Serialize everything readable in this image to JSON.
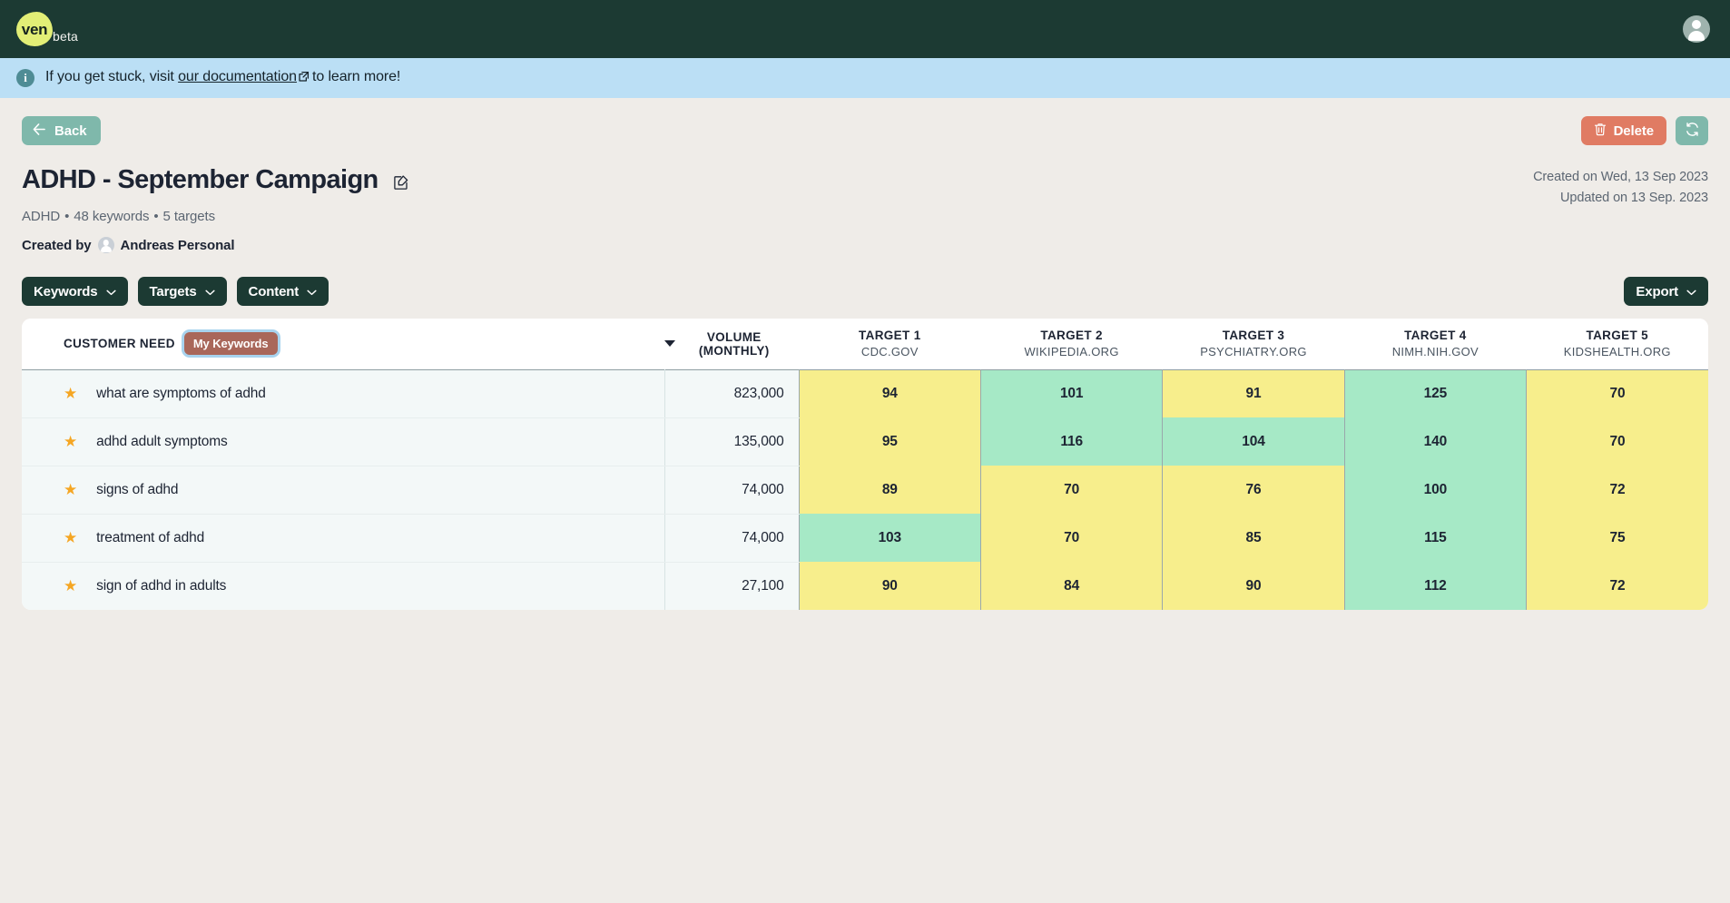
{
  "topbar": {
    "brand_name": "ven",
    "brand_beta": "beta",
    "avatar_icon": "user-avatar-icon"
  },
  "banner": {
    "icon": "info-icon",
    "text_before": "If you get stuck, visit",
    "link_text": "our documentation",
    "external_icon": "external-link-icon",
    "text_after": "to learn more!"
  },
  "actions": {
    "back_label": "Back",
    "back_icon": "arrow-left-icon",
    "delete_label": "Delete",
    "delete_icon": "trash-icon",
    "refresh_icon": "refresh-icon"
  },
  "header": {
    "title": "ADHD - September Campaign",
    "edit_icon": "edit-pencil-icon",
    "topic": "ADHD",
    "keywords_count": "48 keywords",
    "targets_count": "5 targets",
    "created_by_label": "Created by",
    "created_by_name": "Andreas Personal",
    "created_on": "Created on Wed, 13 Sep 2023",
    "updated_on": "Updated on 13 Sep. 2023"
  },
  "filters": {
    "keywords_label": "Keywords",
    "targets_label": "Targets",
    "content_label": "Content",
    "export_label": "Export",
    "chevron_icon": "chevron-down-icon"
  },
  "table": {
    "col_customer_need": "CUSTOMER NEED",
    "my_keywords_label": "My Keywords",
    "col_volume": "VOLUME (MONTHLY)",
    "sort_icon": "caret-down-icon",
    "targets": [
      {
        "label": "TARGET 1",
        "domain": "CDC.GOV"
      },
      {
        "label": "TARGET 2",
        "domain": "WIKIPEDIA.ORG"
      },
      {
        "label": "TARGET 3",
        "domain": "PSYCHIATRY.ORG"
      },
      {
        "label": "TARGET 4",
        "domain": "NIMH.NIH.GOV"
      },
      {
        "label": "TARGET 5",
        "domain": "KIDSHEALTH.ORG"
      }
    ],
    "rows": [
      {
        "starred": true,
        "keyword": "what are symptoms of adhd",
        "volume": "823,000",
        "scores": [
          {
            "value": "94",
            "state": "yellow"
          },
          {
            "value": "101",
            "state": "green"
          },
          {
            "value": "91",
            "state": "yellow"
          },
          {
            "value": "125",
            "state": "green"
          },
          {
            "value": "70",
            "state": "yellow"
          }
        ]
      },
      {
        "starred": true,
        "keyword": "adhd adult symptoms",
        "volume": "135,000",
        "scores": [
          {
            "value": "95",
            "state": "yellow"
          },
          {
            "value": "116",
            "state": "green"
          },
          {
            "value": "104",
            "state": "green"
          },
          {
            "value": "140",
            "state": "green"
          },
          {
            "value": "70",
            "state": "yellow"
          }
        ]
      },
      {
        "starred": true,
        "keyword": "signs of adhd",
        "volume": "74,000",
        "scores": [
          {
            "value": "89",
            "state": "yellow"
          },
          {
            "value": "70",
            "state": "yellow"
          },
          {
            "value": "76",
            "state": "yellow"
          },
          {
            "value": "100",
            "state": "green"
          },
          {
            "value": "72",
            "state": "yellow"
          }
        ]
      },
      {
        "starred": true,
        "keyword": "treatment of adhd",
        "volume": "74,000",
        "scores": [
          {
            "value": "103",
            "state": "green"
          },
          {
            "value": "70",
            "state": "yellow"
          },
          {
            "value": "85",
            "state": "yellow"
          },
          {
            "value": "115",
            "state": "green"
          },
          {
            "value": "75",
            "state": "yellow"
          }
        ]
      },
      {
        "starred": true,
        "keyword": "sign of adhd in adults",
        "volume": "27,100",
        "scores": [
          {
            "value": "90",
            "state": "yellow"
          },
          {
            "value": "84",
            "state": "yellow"
          },
          {
            "value": "90",
            "state": "yellow"
          },
          {
            "value": "112",
            "state": "green"
          },
          {
            "value": "72",
            "state": "yellow"
          }
        ]
      }
    ]
  },
  "annotation": {
    "highlight_target": "My Keywords",
    "oval_color": "#EE2B12",
    "arrow_color": "#EE2B12"
  },
  "colors": {
    "brand_dark": "#1C3A33",
    "brand_lime": "#E2EE76",
    "banner_blue": "#BBDFF5",
    "page_bg": "#EFECE8",
    "teal": "#7FB8AB",
    "danger": "#E07B63",
    "score_yellow": "#F7EE8C",
    "score_green": "#A6E9C6",
    "star_gold": "#F5A623",
    "mykeywords_bg": "#A9675A",
    "focus_ring": "#A8D3EE"
  }
}
